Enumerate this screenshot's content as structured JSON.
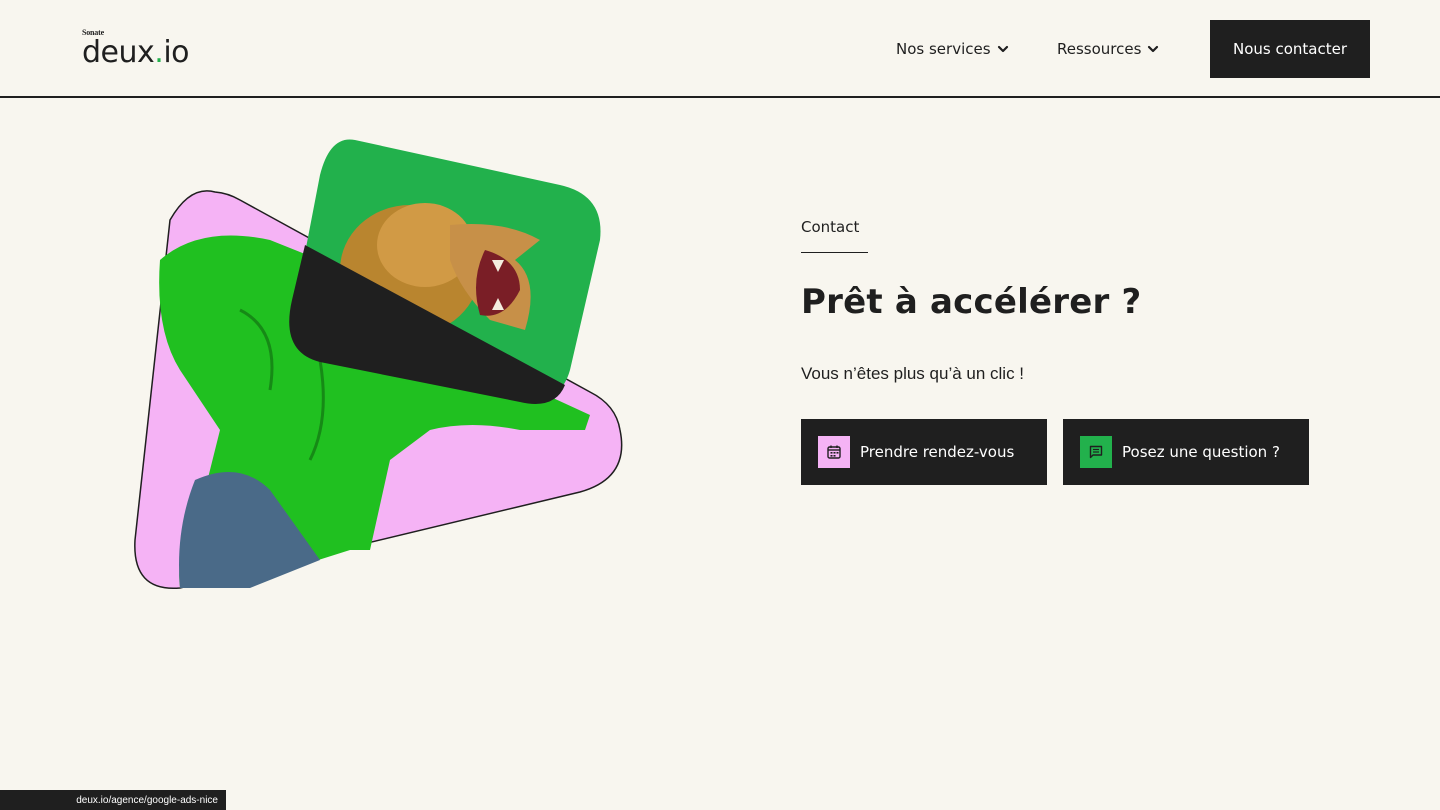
{
  "header": {
    "logo_super": "Sonate",
    "logo_text_a": "deux",
    "logo_dot": ".",
    "logo_text_b": "io",
    "nav": [
      {
        "label": "Nos services",
        "icon": "chevron-down-icon"
      },
      {
        "label": "Ressources",
        "icon": "chevron-down-icon"
      }
    ],
    "cta_label": "Nous contacter"
  },
  "main": {
    "kicker": "Contact",
    "title": "Prêt à accélérer ?",
    "subtitle": "Vous n’êtes plus qu’à un clic !",
    "buttons": [
      {
        "label": "Prendre rendez-vous",
        "icon": "calendar-icon",
        "icon_bg": "#f5b3f5"
      },
      {
        "label": "Posez une question ?",
        "icon": "chat-icon",
        "icon_bg": "#22b14c"
      }
    ]
  },
  "status_bar": {
    "url": "deux.io/agence/google-ads-nice"
  },
  "colors": {
    "background": "#f8f6ef",
    "dark": "#1f1f1f",
    "green": "#22b14c",
    "pink": "#f5b3f5"
  }
}
